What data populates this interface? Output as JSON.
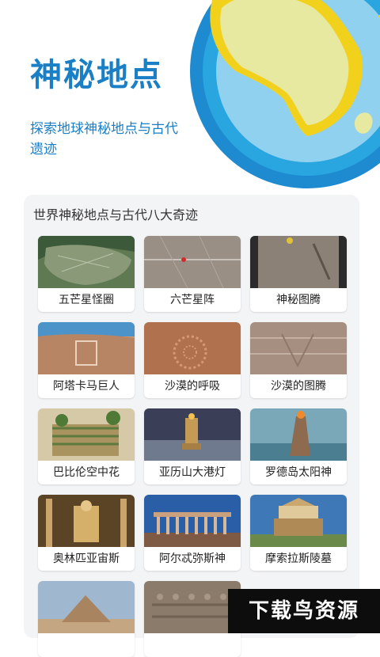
{
  "hero": {
    "title": "神秘地点",
    "subtitle": "探索地球神秘地点与古代遗迹"
  },
  "section": {
    "title": "世界神秘地点与古代八大奇迹"
  },
  "places": [
    {
      "label": "五芒星怪圈"
    },
    {
      "label": "六芒星阵"
    },
    {
      "label": "神秘图腾"
    },
    {
      "label": "阿塔卡马巨人"
    },
    {
      "label": "沙漠的呼吸"
    },
    {
      "label": "沙漠的图腾"
    },
    {
      "label": "巴比伦空中花"
    },
    {
      "label": "亚历山大港灯"
    },
    {
      "label": "罗德岛太阳神"
    },
    {
      "label": "奥林匹亚宙斯"
    },
    {
      "label": "阿尔忒弥斯神"
    },
    {
      "label": "摩索拉斯陵墓"
    },
    {
      "label": ""
    },
    {
      "label": ""
    }
  ],
  "watermark": {
    "text": "下载鸟资源"
  },
  "colors": {
    "accent": "#1a7fc4",
    "ocean_light": "#f2d11d",
    "continent": "#e8e9a0"
  }
}
